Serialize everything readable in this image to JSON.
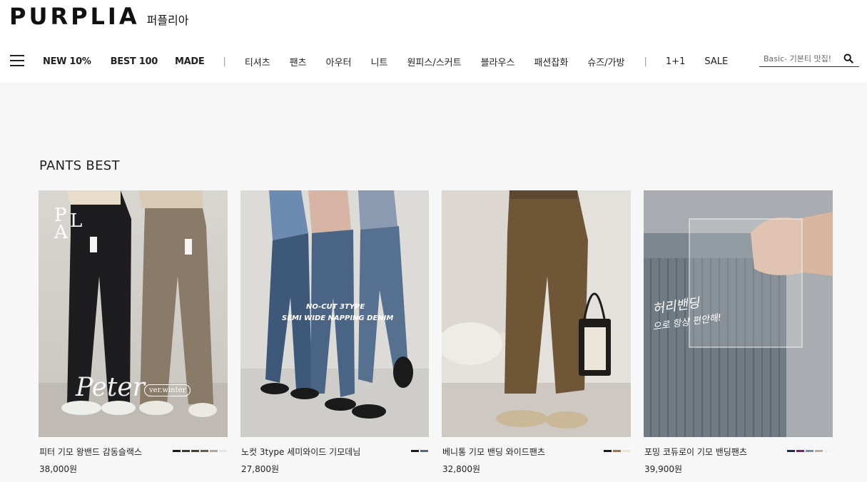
{
  "header": {
    "logo_en": "PURPLIA",
    "logo_ko": "퍼플리아",
    "nav_bold": [
      "NEW 10%",
      "BEST 100",
      "MADE"
    ],
    "nav_categories": [
      "티셔츠",
      "팬츠",
      "아우터",
      "니트",
      "원피스/스커트",
      "블라우스",
      "패션잡화",
      "슈즈/가방"
    ],
    "nav_extra": [
      "1+1",
      "SALE"
    ],
    "search_placeholder": "Basic- 기본티 맛집!"
  },
  "main": {
    "section_title": "PANTS BEST",
    "products": [
      {
        "name": "피터 기모 왕밴드 감동슬랙스",
        "price": "38,000원",
        "image_text": [
          "P",
          "A",
          "L",
          "Peter",
          "ver.winter"
        ],
        "swatches": [
          "#1a1a1a",
          "#3b3530",
          "#4a3a2e",
          "#6b5a48",
          "#b0a69c",
          "#e8e4df"
        ]
      },
      {
        "name": "노컷 3type 세미와이드 기모데님",
        "price": "27,800원",
        "image_text": [
          "NO-CUT 3TYPE",
          "SEMI WIDE NAPPING DENIM"
        ],
        "swatches": [
          "#1a1a1a",
          "#4d6a8c"
        ]
      },
      {
        "name": "베니통 기모 밴딩 와이드팬츠",
        "price": "32,800원",
        "image_text": [],
        "swatches": [
          "#1a1a1a",
          "#a0723f",
          "#ede3d0"
        ]
      },
      {
        "name": "포밍 코듀로이 기모 밴딩팬츠",
        "price": "39,900원",
        "image_text": [
          "허리밴딩",
          "으로 항상 편안해!"
        ],
        "swatches": [
          "#1f2a5c",
          "#7a1f6b",
          "#6f8fb5",
          "#b5aca4",
          "#f4f2ee"
        ]
      }
    ]
  }
}
